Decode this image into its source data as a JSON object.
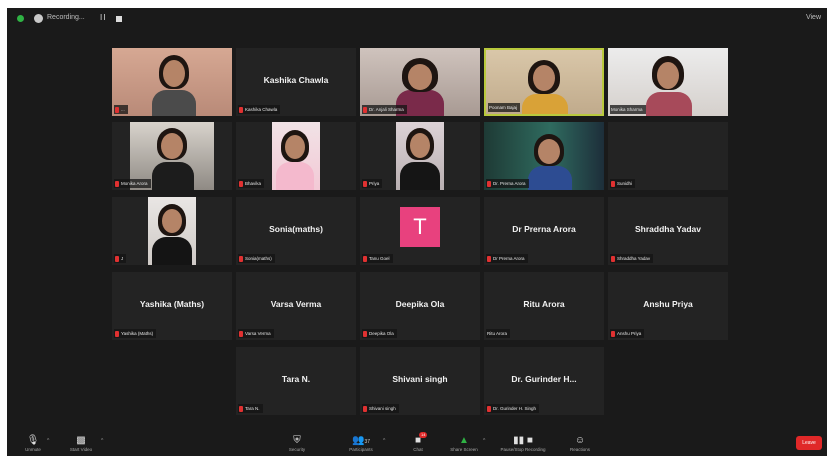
{
  "topbar": {
    "title": "Recording...",
    "pause_symbol": "II",
    "view_label": "View"
  },
  "tiles": [
    {
      "label": "...",
      "big": ""
    },
    {
      "label": "Kashika Chawla",
      "big": "Kashika Chawla"
    },
    {
      "label": "Dr. Anjali Sharma",
      "big": ""
    },
    {
      "label": "Poonam Bajaj",
      "big": ""
    },
    {
      "label": "Monika Sharma",
      "big": ""
    },
    {
      "label": "Monika Arora",
      "big": ""
    },
    {
      "label": "Bhavika",
      "big": ""
    },
    {
      "label": "Priya",
      "big": ""
    },
    {
      "label": "Dr. Prerna Arora",
      "big": ""
    },
    {
      "label": "Sunidhi",
      "big": ""
    },
    {
      "label": "J",
      "big": ""
    },
    {
      "label": "Sonia(maths)",
      "big": "Sonia(maths)"
    },
    {
      "label": "Tanu Goel",
      "big": "",
      "avatar": "T"
    },
    {
      "label": "Dr Prerna Arora",
      "big": "Dr Prerna Arora"
    },
    {
      "label": "Shraddha Yadav",
      "big": "Shraddha Yadav"
    },
    {
      "label": "Yashika (Maths)",
      "big": "Yashika (Maths)"
    },
    {
      "label": "Varsa Verma",
      "big": "Varsa Verma"
    },
    {
      "label": "Deepika Ola",
      "big": "Deepika Ola"
    },
    {
      "label": "Ritu Arora",
      "big": "Ritu Arora"
    },
    {
      "label": "Anshu Priya",
      "big": "Anshu Priya"
    },
    {
      "label": "Tara N.",
      "big": "Tara N."
    },
    {
      "label": "Shivani singh",
      "big": "Shivani singh"
    },
    {
      "label": "Dr. Gurinder H. Singh",
      "big": "Dr. Gurinder H..."
    }
  ],
  "toolbar": {
    "unmute": "Unmute",
    "start_video": "Start Video",
    "security": "Security",
    "participants": "Participants",
    "participants_count": "37",
    "chat": "Chat",
    "chat_badge": "14",
    "share_screen": "Share Screen",
    "pause_recording": "Pause/Stop Recording",
    "reactions": "Reactions",
    "leave": "Leave"
  }
}
